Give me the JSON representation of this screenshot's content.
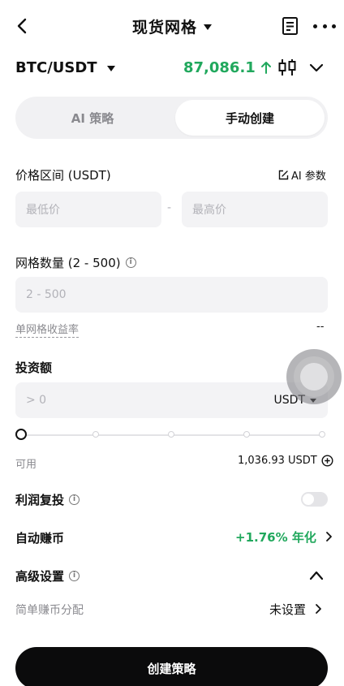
{
  "header": {
    "title": "现货网格"
  },
  "pair": {
    "name": "BTC/USDT",
    "price": "87,086.1",
    "price_color": "#21a85d"
  },
  "tabs": {
    "ai": "AI 策略",
    "manual": "手动创建"
  },
  "price_range": {
    "label": "价格区间 (USDT)",
    "ai_param": "AI 参数",
    "low_placeholder": "最低价",
    "separator": "-",
    "high_placeholder": "最高价"
  },
  "grid": {
    "label": "网格数量 (2 - 500)",
    "placeholder": "2 - 500",
    "yield_label": "单网格收益率",
    "yield_value": "--"
  },
  "investment": {
    "label": "投资额",
    "placeholder": "> 0",
    "currency": "USDT",
    "slider_percent": 0,
    "available_label": "可用",
    "available_value": "1,036.93 USDT"
  },
  "compound": {
    "label": "利润复投",
    "enabled": false
  },
  "auto_earn": {
    "label": "自动赚币",
    "value": "+1.76% 年化"
  },
  "advanced": {
    "label": "高级设置"
  },
  "simple_earn": {
    "label": "简单赚币分配",
    "value": "未设置"
  },
  "cta": {
    "label": "创建策略"
  },
  "icons": {
    "back": "back-arrow-icon",
    "dropdown": "caret-down-icon",
    "doc": "document-icon",
    "more": "more-icon",
    "up": "arrow-up-icon",
    "candle": "candlestick-icon",
    "edit": "edit-icon",
    "info": "info-icon",
    "add": "plus-circle-icon",
    "chevron_right": "chevron-right-icon",
    "chevron_up": "chevron-up-icon",
    "chevron_down": "chevron-down-icon"
  }
}
